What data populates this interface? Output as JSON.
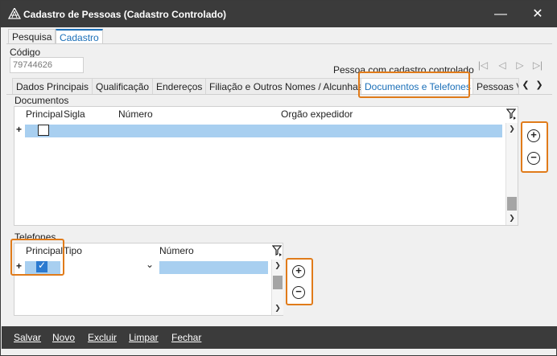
{
  "window": {
    "title": "Cadastro de Pessoas (Cadastro Controlado)",
    "minimize_icon": "minimize-icon",
    "close_icon": "close-icon"
  },
  "top_tabs": [
    "Pesquisa",
    "Cadastro"
  ],
  "codigo": {
    "label": "Código",
    "value": "79744626"
  },
  "status_text": "Pessoa com cadastro controlado",
  "sub_tabs": [
    "Dados Principais",
    "Qualificação",
    "Endereços",
    "Filiação e Outros Nomes / Alcunhas",
    "Documentos e Telefones",
    "Pessoas Vi"
  ],
  "documentos": {
    "label": "Documentos",
    "columns": [
      "Principal",
      "Sigla",
      "Número",
      "Orgão expedidor"
    ],
    "new_row_marker": "+",
    "principal_checked": false
  },
  "telefones": {
    "label": "Telefones",
    "columns": [
      "Principal",
      "Tipo",
      "Número"
    ],
    "new_row_marker": "+",
    "principal_checked": true
  },
  "bottom_actions": [
    "Salvar",
    "Novo",
    "Excluir",
    "Limpar",
    "Fechar"
  ],
  "colors": {
    "accent": "#1a6fb8",
    "highlight": "#e07b1a",
    "titlebar": "#3b3b3b",
    "selection": "#a8cff0"
  }
}
